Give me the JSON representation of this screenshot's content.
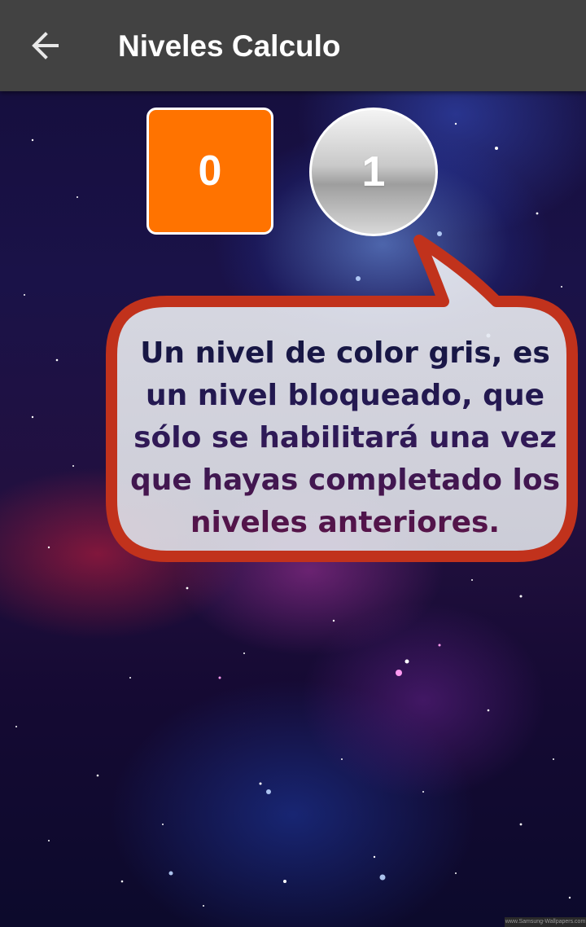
{
  "appbar": {
    "back_icon": "arrow-left-icon",
    "title": "Niveles Calculo"
  },
  "levels": [
    {
      "label": "0",
      "state": "unlocked",
      "color": "#ff7300"
    },
    {
      "label": "1",
      "state": "locked",
      "color": "#c0c0c0"
    }
  ],
  "tooltip": {
    "text": "Un nivel de color gris, es un nivel bloqueado, que sólo se habilitará una vez que hayas completado los niveles anteriores.",
    "border_color": "#c1321c"
  },
  "watermark": "www.Samsung-Wallpapers.com"
}
